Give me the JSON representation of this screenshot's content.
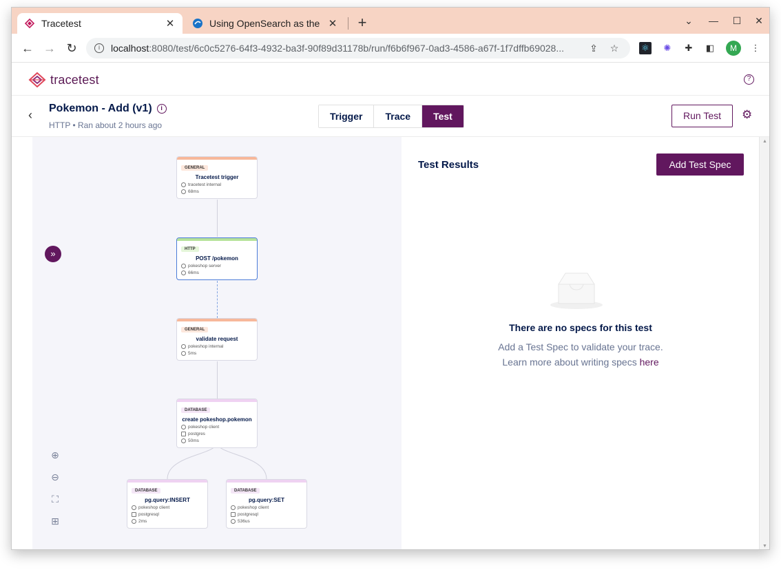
{
  "browser": {
    "tabs": [
      {
        "title": "Tracetest",
        "active": true
      },
      {
        "title": "Using OpenSearch as the",
        "active": false
      }
    ],
    "new_tab": "+",
    "url_host": "localhost",
    "url_rest": ":8080/test/6c0c5276-64f3-4932-ba3f-90f89d31178b/run/f6b6f967-0ad3-4586-a67f-1f7dffb69028...",
    "avatar_letter": "M"
  },
  "app": {
    "logo_text": "tracetest",
    "help": "?"
  },
  "test": {
    "title": "Pokemon - Add (v1)",
    "subtitle": "HTTP • Ran about 2 hours ago",
    "tabs": [
      "Trigger",
      "Trace",
      "Test"
    ],
    "active_tab": "Test",
    "run_button": "Run Test"
  },
  "diagram": {
    "nodes": [
      {
        "badge": "GENERAL",
        "name": "Tracetest trigger",
        "meta": [
          "tracetest internal",
          "68ms"
        ]
      },
      {
        "badge": "HTTP",
        "name": "POST /pokemon",
        "meta": [
          "pokeshop server",
          "66ms"
        ]
      },
      {
        "badge": "GENERAL",
        "name": "validate request",
        "meta": [
          "pokeshop internal",
          "5ms"
        ]
      },
      {
        "badge": "DATABASE",
        "name": "create pokeshop.pokemon",
        "meta": [
          "pokeshop client",
          "postgres",
          "50ms"
        ]
      },
      {
        "badge": "DATABASE",
        "name": "pg.query:INSERT",
        "meta": [
          "pokeshop client",
          "postgresql",
          "2ms"
        ]
      },
      {
        "badge": "DATABASE",
        "name": "pg.query:SET",
        "meta": [
          "pokeshop client",
          "postgresql",
          "536us"
        ]
      }
    ]
  },
  "results": {
    "title": "Test Results",
    "add_button": "Add Test Spec",
    "empty_title": "There are no specs for this test",
    "empty_line1": "Add a Test Spec to validate your trace.",
    "empty_line2": "Learn more about writing specs ",
    "empty_link": "here"
  },
  "colors": {
    "brand": "#61175e",
    "general": "#f7b89a",
    "http": "#b7e39b",
    "database": "#efd2f2",
    "selected_border": "#4a7bd8"
  }
}
